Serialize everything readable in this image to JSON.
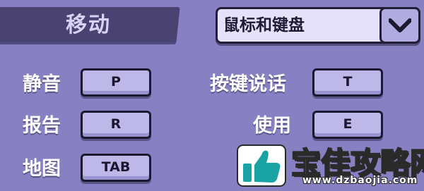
{
  "header": {
    "title": "移动"
  },
  "dropdown": {
    "selected": "鼠标和键盘",
    "icon": "chevron-down-icon"
  },
  "bindings": [
    {
      "label": "静音",
      "key": "P"
    },
    {
      "label": "报告",
      "key": "R"
    },
    {
      "label": "地图",
      "key": "TAB"
    },
    {
      "label": "按键说话",
      "key": "T"
    },
    {
      "label": "使用",
      "key": "E"
    }
  ],
  "watermark": {
    "title": "宝佳攻略网",
    "url": "www.dzbaojia.com",
    "icon": "thumbs-up-icon"
  },
  "colors": {
    "background": "#8780c2",
    "title_bar": "#4a4270",
    "key_fill": "#bdb8e8",
    "dropdown_fill": "#e6e2fb"
  }
}
